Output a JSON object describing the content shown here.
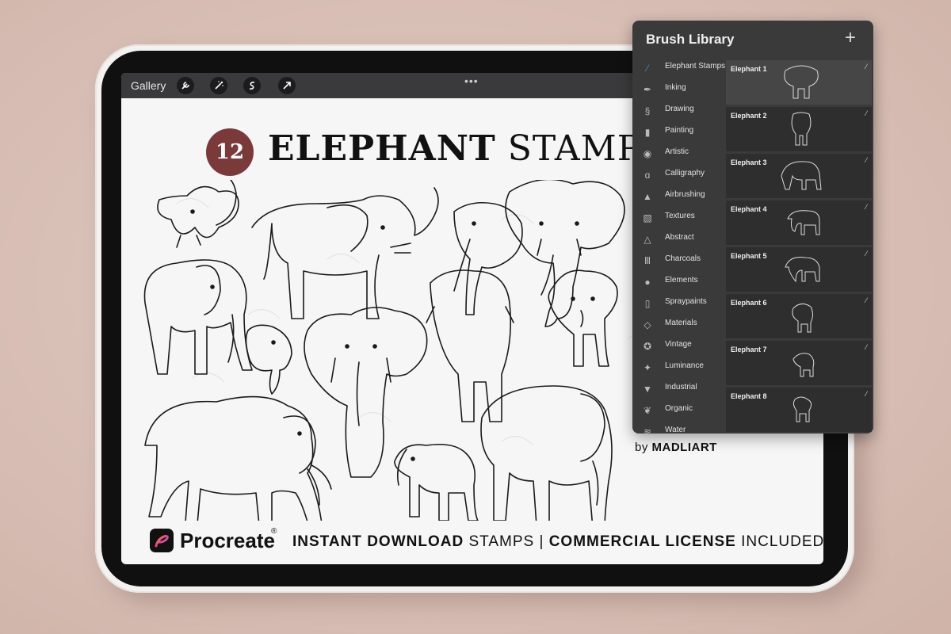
{
  "toolbar": {
    "gallery_label": "Gallery",
    "tool_icons": [
      "wrench-icon",
      "magic-wand-icon",
      "selection-icon",
      "transform-arrow-icon"
    ],
    "more_dots": "•••"
  },
  "canvas": {
    "badge_number": "12",
    "title_word1": "ELEPHANT",
    "title_word2": "STAMPS",
    "byline_prefix": "by",
    "byline_name": "MADLIART",
    "footer": {
      "brand": "Procreate",
      "registered": "®",
      "part1_strong": "INSTANT DOWNLOAD",
      "part1_rest": "STAMPS |",
      "part2_strong": "COMMERCIAL LICENSE",
      "part2_rest": "INCLUDED"
    }
  },
  "brush_library": {
    "title": "Brush Library",
    "add_label": "+",
    "categories": [
      {
        "label": "Elephant Stamps",
        "icon": "brush-stroke-icon"
      },
      {
        "label": "Inking",
        "icon": "ink-pen-icon"
      },
      {
        "label": "Drawing",
        "icon": "squiggle-icon"
      },
      {
        "label": "Painting",
        "icon": "paint-brush-icon"
      },
      {
        "label": "Artistic",
        "icon": "palette-icon"
      },
      {
        "label": "Calligraphy",
        "icon": "calligraphy-icon"
      },
      {
        "label": "Airbrushing",
        "icon": "airbrush-icon"
      },
      {
        "label": "Textures",
        "icon": "texture-icon"
      },
      {
        "label": "Abstract",
        "icon": "triangle-icon"
      },
      {
        "label": "Charcoals",
        "icon": "charcoal-icon"
      },
      {
        "label": "Elements",
        "icon": "globe-icon"
      },
      {
        "label": "Spraypaints",
        "icon": "spray-can-icon"
      },
      {
        "label": "Materials",
        "icon": "cube-icon"
      },
      {
        "label": "Vintage",
        "icon": "star-badge-icon"
      },
      {
        "label": "Luminance",
        "icon": "sparkle-icon"
      },
      {
        "label": "Industrial",
        "icon": "anvil-icon"
      },
      {
        "label": "Organic",
        "icon": "leaf-icon"
      },
      {
        "label": "Water",
        "icon": "waves-icon"
      }
    ],
    "brushes": [
      {
        "label": "Elephant 1"
      },
      {
        "label": "Elephant 2"
      },
      {
        "label": "Elephant 3"
      },
      {
        "label": "Elephant 4"
      },
      {
        "label": "Elephant 5"
      },
      {
        "label": "Elephant 6"
      },
      {
        "label": "Elephant 7"
      },
      {
        "label": "Elephant 8"
      }
    ],
    "active_category_index": 0,
    "active_brush_index": 0
  },
  "colors": {
    "badge": "#7a3a3a",
    "accent": "#3b8de0",
    "panel": "#3a3a3a"
  }
}
